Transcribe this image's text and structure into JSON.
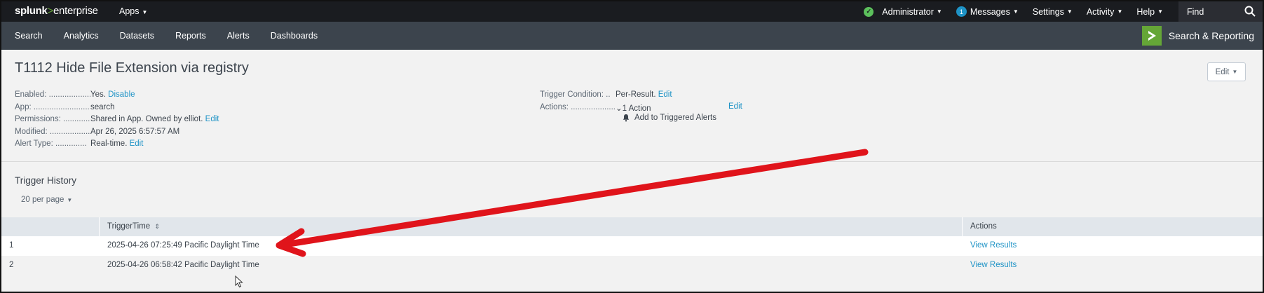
{
  "topbar": {
    "logo_main": "splunk",
    "logo_gt": ">",
    "logo_suffix": "enterprise",
    "apps_label": "Apps",
    "status_icon": "check-circle-icon",
    "items": [
      {
        "label": "Administrator"
      },
      {
        "label": "Messages",
        "badge": "1"
      },
      {
        "label": "Settings"
      },
      {
        "label": "Activity"
      },
      {
        "label": "Help"
      }
    ],
    "find_label": "Find"
  },
  "appbar": {
    "nav": [
      "Search",
      "Analytics",
      "Datasets",
      "Reports",
      "Alerts",
      "Dashboards"
    ],
    "app_title": "Search & Reporting"
  },
  "alert": {
    "title": "T1112 Hide File Extension via registry",
    "edit_button": "Edit",
    "properties": [
      {
        "label": "Enabled: ......................",
        "value": "Yes.",
        "link": "Disable"
      },
      {
        "label": "App: ..............................",
        "value": "search",
        "link": ""
      },
      {
        "label": "Permissions: ............",
        "value": "Shared in App. Owned by elliot.",
        "link": "Edit"
      },
      {
        "label": "Modified: ....................",
        "value": "Apr 26, 2025 6:57:57 AM",
        "link": ""
      },
      {
        "label": "Alert Type: ..............",
        "value": "Real-time.",
        "link": "Edit"
      }
    ],
    "trigger_condition": {
      "label": "Trigger Condition: ..",
      "value": "Per-Result.",
      "link": "Edit"
    },
    "actions": {
      "label": "Actions: ....................",
      "value": "1 Action",
      "link": "Edit",
      "sub_action": "Add to Triggered Alerts"
    }
  },
  "history": {
    "title": "Trigger History",
    "per_page": "20 per page",
    "columns": {
      "time": "TriggerTime",
      "actions": "Actions"
    },
    "rows": [
      {
        "num": "1",
        "time": "2025-04-26 07:25:49 Pacific Daylight Time",
        "action": "View Results"
      },
      {
        "num": "2",
        "time": "2025-04-26 06:58:42 Pacific Daylight Time",
        "action": "View Results"
      }
    ]
  },
  "colors": {
    "topbar": "#1a1c20",
    "appbar": "#3c444d",
    "accent": "#65a637",
    "link": "#1e93c6",
    "annotation_arrow": "#e0141b"
  }
}
